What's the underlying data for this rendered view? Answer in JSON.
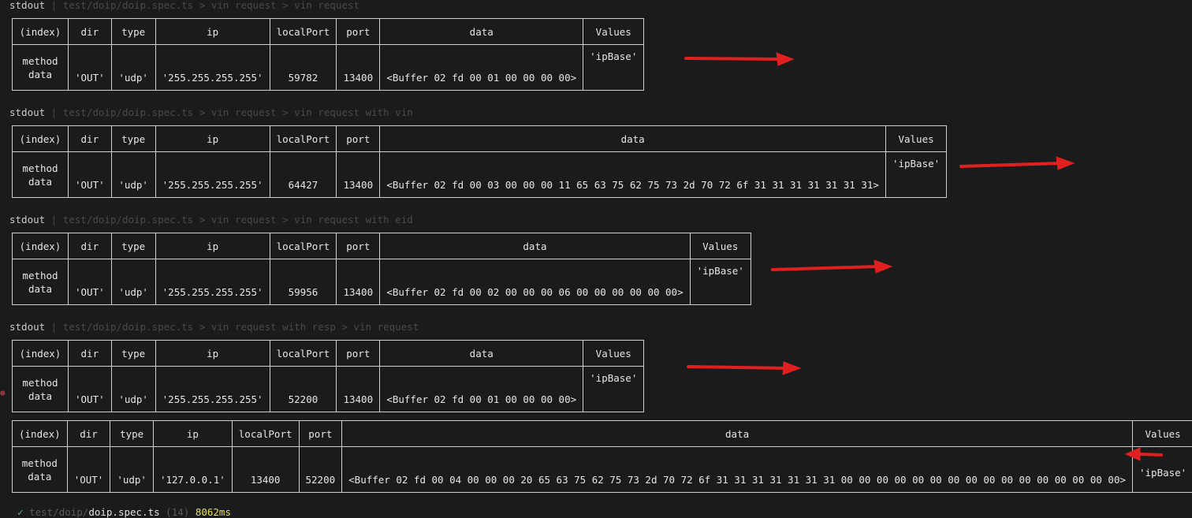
{
  "headers": [
    {
      "label": "stdout",
      "sep": " | ",
      "path": "test/doip/doip.spec.ts > vin request > vin request"
    },
    {
      "label": "stdout",
      "sep": " | ",
      "path": "test/doip/doip.spec.ts > vin request > vin request with vin"
    },
    {
      "label": "stdout",
      "sep": " | ",
      "path": "test/doip/doip.spec.ts > vin request > vin request with eid"
    },
    {
      "label": "stdout",
      "sep": " | ",
      "path": "test/doip/doip.spec.ts > vin request with resp > vin request"
    }
  ],
  "columns": [
    "(index)",
    "dir",
    "type",
    "ip",
    "localPort",
    "port",
    "data",
    "Values"
  ],
  "tables": [
    {
      "index_line1": "method",
      "index_line2": "data",
      "dir": "'OUT'",
      "type": "'udp'",
      "ip": "'255.255.255.255'",
      "localPort": "59782",
      "port": "13400",
      "data": "<Buffer 02 fd 00 01 00 00 00 00>",
      "values": "'ipBase'"
    },
    {
      "index_line1": "method",
      "index_line2": "data",
      "dir": "'OUT'",
      "type": "'udp'",
      "ip": "'255.255.255.255'",
      "localPort": "64427",
      "port": "13400",
      "data": "<Buffer 02 fd 00 03 00 00 00 11 65 63 75 62 75 73 2d 70 72 6f 31 31 31 31 31 31 31>",
      "values": "'ipBase'"
    },
    {
      "index_line1": "method",
      "index_line2": "data",
      "dir": "'OUT'",
      "type": "'udp'",
      "ip": "'255.255.255.255'",
      "localPort": "59956",
      "port": "13400",
      "data": "<Buffer 02 fd 00 02 00 00 00 06 00 00 00 00 00 00>",
      "values": "'ipBase'"
    },
    {
      "index_line1": "method",
      "index_line2": "data",
      "dir": "'OUT'",
      "type": "'udp'",
      "ip": "'255.255.255.255'",
      "localPort": "52200",
      "port": "13400",
      "data": "<Buffer 02 fd 00 01 00 00 00 00>",
      "values": "'ipBase'"
    },
    {
      "index_line1": "method",
      "index_line2": "data",
      "dir": "'OUT'",
      "type": "'udp'",
      "ip": "'127.0.0.1'",
      "localPort": "13400",
      "port": "52200",
      "data": "<Buffer 02 fd 00 04 00 00 00 20 65 63 75 62 75 73 2d 70 72 6f 31 31 31 31 31 31 31 00 00 00 00 00 00 00 00 00 00 00 00 00 00 00 00>",
      "values": "'ipBase'"
    }
  ],
  "error_icon": "error-circle-icon",
  "footer": {
    "check": "✓",
    "dir_prefix": "test/doip/",
    "file": "doip.spec.ts",
    "count": "(14)",
    "time": "8062ms"
  },
  "colors": {
    "background": "#1b1b1b",
    "string": "#3fbf7f",
    "number": "#e8e04a",
    "arrow": "#e02020",
    "border": "#cfcfcf"
  }
}
